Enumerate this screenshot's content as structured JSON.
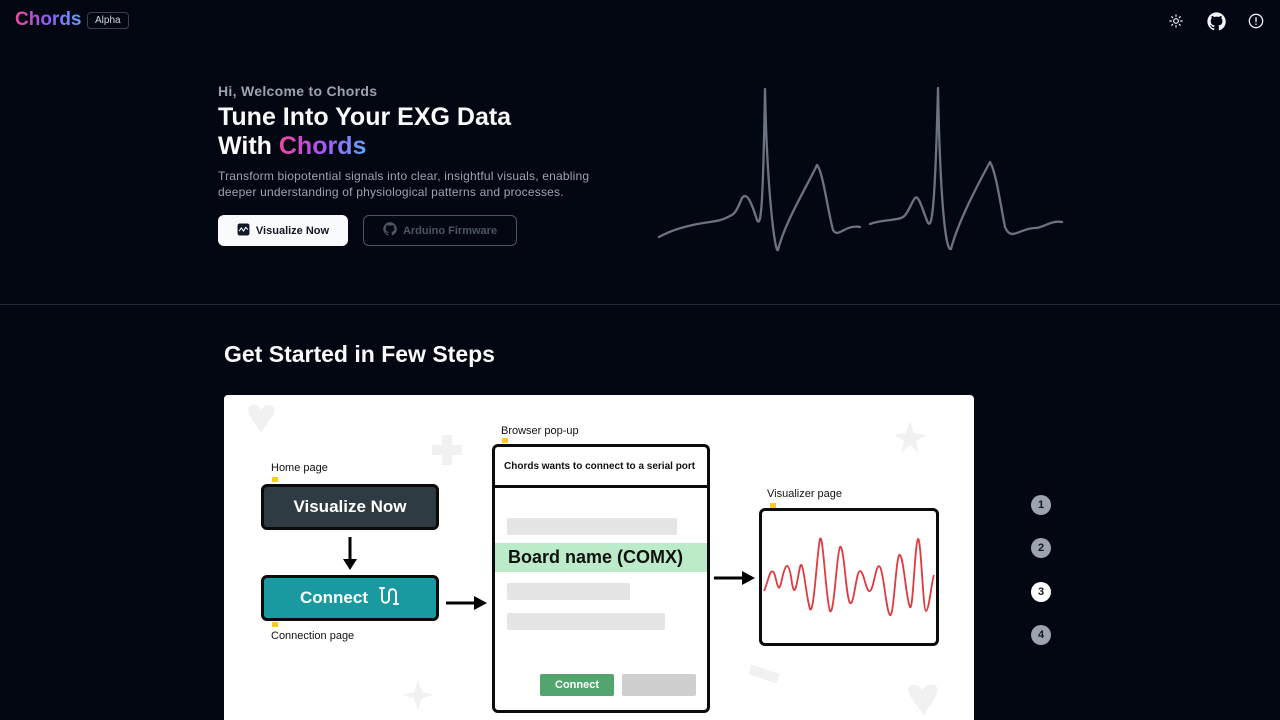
{
  "nav": {
    "brand": "Chords",
    "badge": "Alpha",
    "icons": [
      "sun-icon",
      "github-icon",
      "info-icon"
    ]
  },
  "hero": {
    "welcome": "Hi, Welcome to Chords",
    "title_line1": "Tune Into Your EXG Data",
    "title_line2_prefix": "With ",
    "title_line2_accent": "Chords",
    "description": "Transform biopotential signals into clear, insightful visuals, enabling deeper understanding of physiological patterns and processes.",
    "primary_button": "Visualize Now",
    "secondary_button": "Arduino Firmware"
  },
  "steps": {
    "title": "Get Started in Few Steps",
    "diagram": {
      "home_label": "Home page",
      "home_button": "Visualize Now",
      "connection_label": "Connection page",
      "connect_button": "Connect",
      "popup_label": "Browser pop-up",
      "popup_header": "Chords wants to connect to a serial port",
      "board_name": "Board name (COMX)",
      "popup_connect": "Connect",
      "visualizer_label": "Visualizer page"
    },
    "numbers": [
      "1",
      "2",
      "3",
      "4"
    ],
    "active_step": "3"
  },
  "colors": {
    "background": "#030712",
    "accent_gradient": [
      "#ec4899",
      "#a855f7",
      "#60a5fa"
    ],
    "connect_teal": "#1a9aa0",
    "home_dark": "#2f3b42",
    "popup_green": "#52a56c",
    "signal_red": "#e0393e"
  }
}
